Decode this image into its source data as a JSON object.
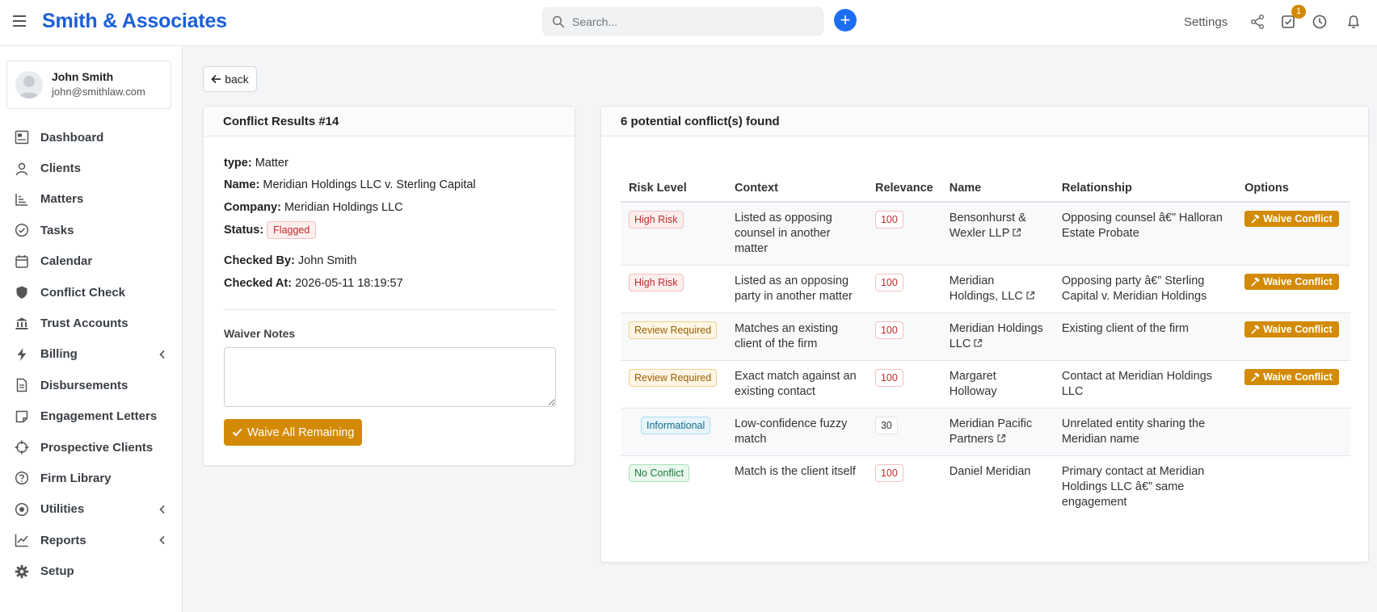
{
  "header": {
    "brand": "Smith & Associates",
    "search_placeholder": "Search...",
    "settings_label": "Settings",
    "notification_count": "1",
    "accent_color": "#1b5fd6"
  },
  "user": {
    "name": "John Smith",
    "email": "john@smithlaw.com"
  },
  "sidebar": {
    "items": [
      {
        "label": "Dashboard",
        "icon": "dashboard-icon"
      },
      {
        "label": "Clients",
        "icon": "user-icon"
      },
      {
        "label": "Matters",
        "icon": "chart-bars-icon"
      },
      {
        "label": "Tasks",
        "icon": "check-circle-icon"
      },
      {
        "label": "Calendar",
        "icon": "calendar-icon"
      },
      {
        "label": "Conflict Check",
        "icon": "shield-icon"
      },
      {
        "label": "Trust Accounts",
        "icon": "bank-icon"
      },
      {
        "label": "Billing",
        "icon": "lightning-icon"
      },
      {
        "label": "Disbursements",
        "icon": "document-icon"
      },
      {
        "label": "Engagement Letters",
        "icon": "note-icon"
      },
      {
        "label": "Prospective Clients",
        "icon": "crosshair-icon"
      },
      {
        "label": "Firm Library",
        "icon": "question-circle-icon"
      },
      {
        "label": "Utilities",
        "icon": "record-icon"
      },
      {
        "label": "Reports",
        "icon": "line-chart-icon"
      },
      {
        "label": "Setup",
        "icon": "gear-icon"
      }
    ]
  },
  "back_label": "back",
  "conflict": {
    "title": "Conflict Results #14",
    "type_label": "type:",
    "type_value": "Matter",
    "name_label": "Name:",
    "name_value": "Meridian Holdings LLC v. Sterling Capital",
    "company_label": "Company:",
    "company_value": "Meridian Holdings LLC",
    "status_label": "Status:",
    "status_value": "Flagged",
    "checked_by_label": "Checked By:",
    "checked_by_value": "John Smith",
    "checked_at_label": "Checked At:",
    "checked_at_value": "2026-05-11 18:19:57",
    "waiver_notes_label": "Waiver Notes",
    "waiver_notes_value": "",
    "waive_all_label": "Waive All Remaining"
  },
  "results": {
    "title": "6 potential conflict(s) found",
    "columns": [
      "Risk Level",
      "Context",
      "Relevance",
      "Name",
      "Relationship",
      "Options"
    ],
    "waive_label": "Waive Conflict",
    "rows": [
      {
        "risk": "High Risk",
        "risk_kind": "high",
        "context": "Listed as opposing counsel in another matter",
        "relevance": "100",
        "name": "Bensonhurst & Wexler LLP",
        "link": true,
        "relationship": "Opposing counsel â€” Halloran Estate Probate",
        "waivable": true
      },
      {
        "risk": "High Risk",
        "risk_kind": "high",
        "context": "Listed as an opposing party in another matter",
        "relevance": "100",
        "name": "Meridian Holdings, LLC",
        "link": true,
        "relationship": "Opposing party â€” Sterling Capital v. Meridian Holdings",
        "waivable": true
      },
      {
        "risk": "Review Required",
        "risk_kind": "review",
        "context": "Matches an existing client of the firm",
        "relevance": "100",
        "name": "Meridian Holdings LLC",
        "link": true,
        "relationship": "Existing client of the firm",
        "waivable": true
      },
      {
        "risk": "Review Required",
        "risk_kind": "review",
        "context": "Exact match against an existing contact",
        "relevance": "100",
        "name": "Margaret Holloway",
        "link": false,
        "relationship": "Contact at Meridian Holdings LLC",
        "waivable": true
      },
      {
        "risk": "Informational",
        "risk_kind": "info",
        "context": "Low-confidence fuzzy match",
        "relevance": "30",
        "name": "Meridian Pacific Partners",
        "link": true,
        "relationship": "Unrelated entity sharing the Meridian name",
        "waivable": false
      },
      {
        "risk": "No Conflict",
        "risk_kind": "none",
        "context": "Match is the client itself",
        "relevance": "100",
        "name": "Daniel Meridian",
        "link": false,
        "relationship": "Primary contact at Meridian Holdings LLC â€” same engagement",
        "waivable": false
      }
    ]
  }
}
